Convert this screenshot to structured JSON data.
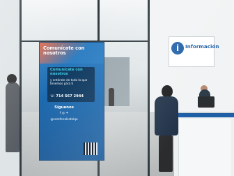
{
  "banner": {
    "headline": "Comunícate con nosotros",
    "subheadline": "Comunícate con nosotros",
    "body": "y entérate de todo lo que tenemos para ti",
    "phone": "☏ 714 567 2944",
    "follow": "Síguenos",
    "social_icons": "f ◎ ✦",
    "handle": "@comfenalcotolqa"
  },
  "sign": {
    "icon": "info-icon",
    "label": "Información"
  },
  "colors": {
    "banner_blue": "#1e6bb0",
    "accent_cyan": "#43d0e7",
    "accent_orange": "#e46a4a",
    "counter_blue": "#1f5fa6"
  }
}
